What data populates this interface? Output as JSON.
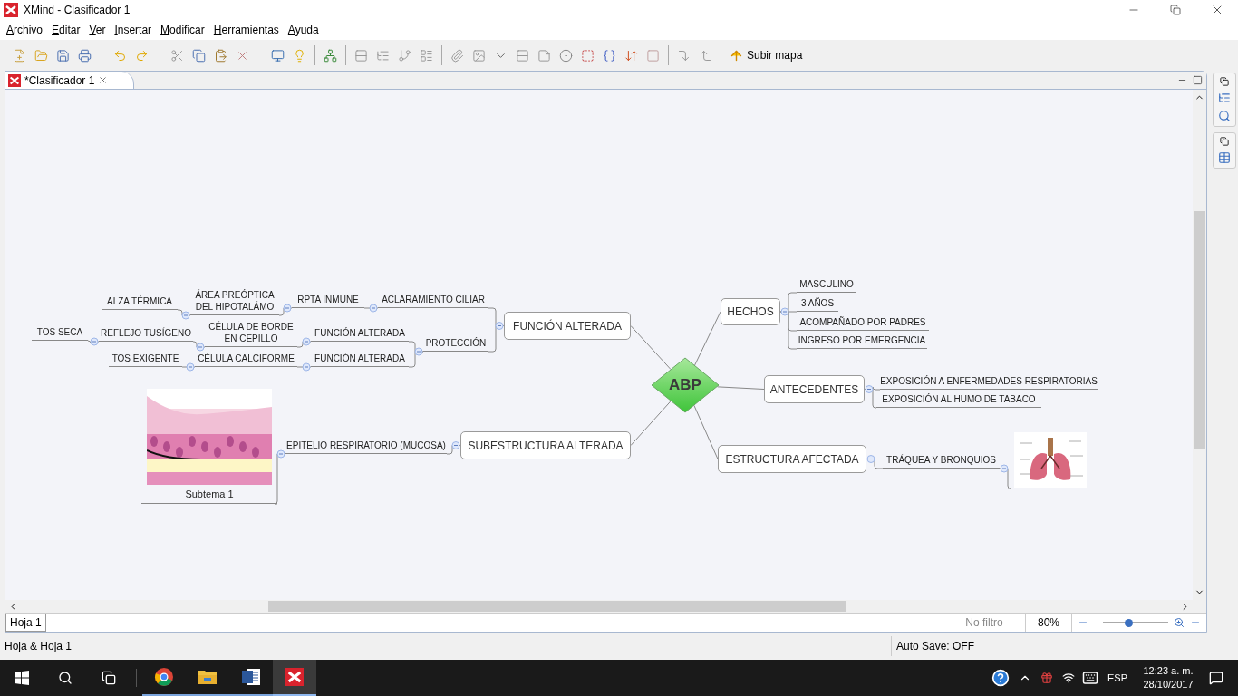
{
  "window": {
    "title": "XMind - Clasificador 1"
  },
  "menu": [
    "Archivo",
    "Editar",
    "Ver",
    "Insertar",
    "Modificar",
    "Herramientas",
    "Ayuda"
  ],
  "toolbar": {
    "upload_button": "Subir mapa"
  },
  "editor_tab": {
    "label": "*Clasificador 1",
    "selected": true
  },
  "map": {
    "central": "ABP",
    "branches": [
      {
        "label": "FUNCIÓN ALTERADA",
        "children": [
          {
            "label": "ACLARAMIENTO CILIAR",
            "children": [
              {
                "label": "RPTA INMUNE",
                "children": [
                  {
                    "label": "ÁREA PREÓPTICA\nDEL HIPOTALÁMO",
                    "children": [
                      {
                        "label": "ALZA TÉRMICA"
                      }
                    ]
                  }
                ]
              }
            ]
          },
          {
            "label": "PROTECCIÓN",
            "children": [
              {
                "label": "FUNCIÓN ALTERADA",
                "children": [
                  {
                    "label": "CÉLULA DE BORDE\nEN CEPILLO",
                    "children": [
                      {
                        "label": "REFLEJO TUSÍGENO",
                        "children": [
                          {
                            "label": "TOS SECA"
                          }
                        ]
                      }
                    ]
                  }
                ]
              },
              {
                "label": "FUNCIÓN ALTERADA",
                "children": [
                  {
                    "label": "CÉLULA CALCIFORME",
                    "children": [
                      {
                        "label": "TOS EXIGENTE"
                      }
                    ]
                  }
                ]
              }
            ]
          }
        ]
      },
      {
        "label": "SUBESTRUCTURA ALTERADA",
        "children": [
          {
            "label": "EPITELIO RESPIRATORIO (MUCOSA)",
            "children": [
              {
                "kind": "picture",
                "label": "Subtema 1"
              }
            ]
          }
        ]
      },
      {
        "label": "HECHOS",
        "children": [
          {
            "label": "MASCULINO"
          },
          {
            "label": "3 AÑOS"
          },
          {
            "label": "ACOMPAÑADO POR PADRES"
          },
          {
            "label": "INGRESO POR EMERGENCIA"
          }
        ]
      },
      {
        "label": "ANTECEDENTES",
        "children": [
          {
            "label": "EXPOSICIÓN A ENFERMEDADES RESPIRATORIAS"
          },
          {
            "label": "EXPOSICIÓN AL HUMO DE TABACO"
          }
        ]
      },
      {
        "label": "ESTRUCTURA AFECTADA",
        "children": [
          {
            "label": "TRÁQUEA Y BRONQUIOS"
          }
        ]
      }
    ]
  },
  "sheet_tabs": [
    {
      "label": "Hoja 1",
      "selected": true
    }
  ],
  "editor_status": {
    "filter": "No filtro",
    "zoom": "80%",
    "zoom_slider": {
      "level": 0.39
    }
  },
  "status_bar": {
    "left": "Hoja & Hoja 1",
    "autosave": "Auto Save: OFF"
  },
  "taskbar": {
    "apps": [
      {
        "kind": "chrome",
        "selected": false
      },
      {
        "kind": "explorer",
        "selected": false
      },
      {
        "kind": "word",
        "selected": false
      },
      {
        "kind": "xmind",
        "selected": true
      }
    ],
    "language": "ESP",
    "time": "12:23 a. m.",
    "date": "28/10/2017"
  }
}
